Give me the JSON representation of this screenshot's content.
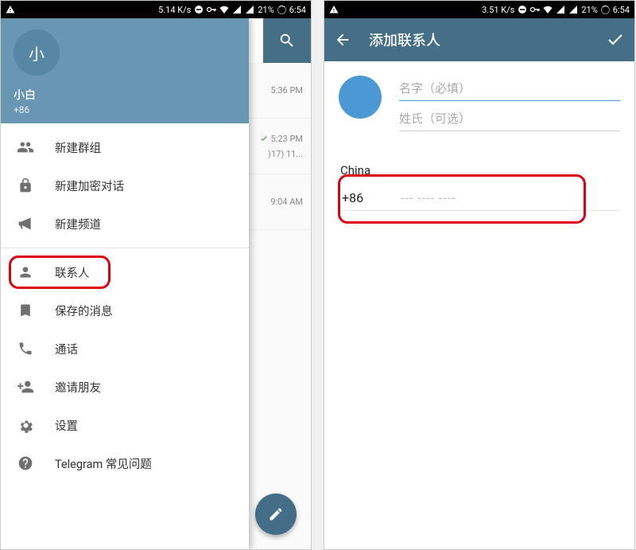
{
  "statusbar": {
    "left_speed": "5.14 K/s",
    "right_speed": "3.51 K/s",
    "battery_pct": "21%",
    "time": "6:54"
  },
  "left": {
    "drawer": {
      "avatar_initial": "小",
      "user_name": "小白",
      "user_phone": "+86",
      "items": [
        {
          "label": "新建群组"
        },
        {
          "label": "新建加密对话"
        },
        {
          "label": "新建频道"
        },
        {
          "label": "联系人"
        },
        {
          "label": "保存的消息"
        },
        {
          "label": "通话"
        },
        {
          "label": "邀请朋友"
        },
        {
          "label": "设置"
        },
        {
          "label": "Telegram 常见问题"
        }
      ]
    },
    "chat_remnants": [
      {
        "time": "5:36 PM",
        "extra": ""
      },
      {
        "time": "5:23 PM",
        "extra": ")17) 11...",
        "checked": true
      },
      {
        "time": "9:04 AM",
        "extra": ""
      }
    ]
  },
  "right": {
    "title": "添加联系人",
    "first_name_placeholder": "名字（必填）",
    "last_name_placeholder": "姓氏（可选）",
    "country": "China",
    "country_code": "+86",
    "phone_placeholder": "--- ---- ----"
  }
}
